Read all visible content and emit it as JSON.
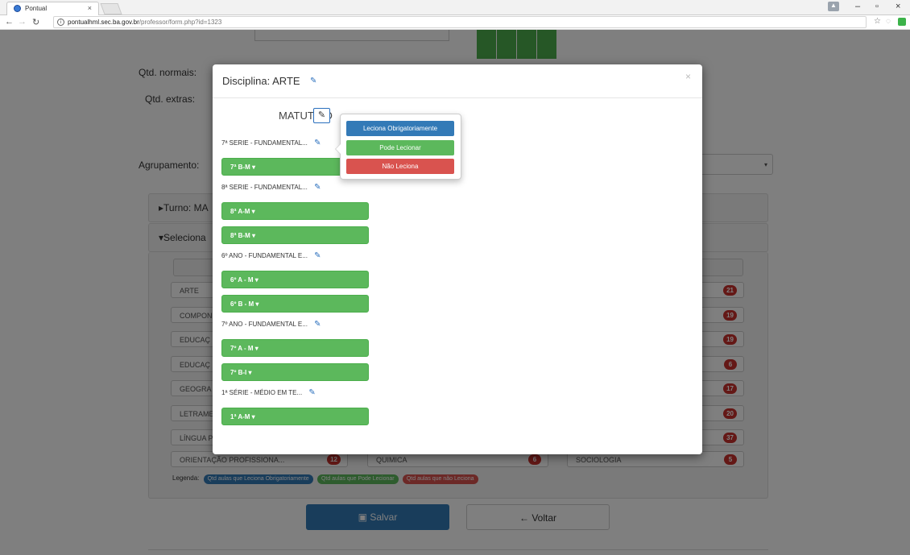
{
  "browser": {
    "tab_title": "Pontual",
    "url_host": "pontualhml.sec.ba.gov.br",
    "url_path": "/professor/form.php?id=1323",
    "tab_close": "×",
    "min": "–",
    "max": "▫",
    "close": "×",
    "star": "☆"
  },
  "page": {
    "qtd_normais": "Qtd. normais:",
    "qtd_extras": "Qtd. extras:",
    "agrupamento": "Agrupamento:",
    "turno": "▸Turno: MA",
    "seleciona": "▾Seleciona",
    "subjects": [
      {
        "name": "ARTE",
        "count": "21"
      },
      {
        "name": "COMPON",
        "count": "19"
      },
      {
        "name": "EDUCAÇ",
        "count": "19"
      },
      {
        "name": "EDUCAÇ",
        "count": "6"
      },
      {
        "name": "GEOGRA",
        "count": "17"
      },
      {
        "name": "LETRAME",
        "count": "20"
      },
      {
        "name": "LÍNGUA P",
        "count": "37"
      }
    ],
    "bottom_row": [
      {
        "name": "ORIENTAÇÃO PROFISSIONA...",
        "count": "12"
      },
      {
        "name": "QUIMICA",
        "count": "6"
      },
      {
        "name": "SOCIOLOGIA",
        "count": "5"
      }
    ],
    "legend_label": "Legenda:",
    "legend": [
      {
        "text": "Qtd aulas que Leciona Obrigatoriamente",
        "color": "#337ab7"
      },
      {
        "text": "Qtd aulas que Pode Lecionar",
        "color": "#5cb85c"
      },
      {
        "text": "Qtd aulas que não Leciona",
        "color": "#d9534f"
      }
    ],
    "save_label": "Salvar",
    "back_label": "Voltar"
  },
  "modal": {
    "title": "Disciplina: ARTE",
    "close": "×",
    "shift": "MATUTINO",
    "groups": [
      {
        "title": "7ª SERIE - FUNDAMENTAL...",
        "classes": [
          "7ª B-M ▾"
        ]
      },
      {
        "title": "8ª SERIE - FUNDAMENTAL...",
        "classes": [
          "8ª A-M ▾",
          "8ª B-M ▾"
        ]
      },
      {
        "title": "6º ANO - FUNDAMENTAL E...",
        "classes": [
          "6º A - M ▾",
          "6º B - M ▾"
        ]
      },
      {
        "title": "7º ANO - FUNDAMENTAL E...",
        "classes": [
          "7º A - M ▾",
          "7º B-I ▾"
        ]
      },
      {
        "title": "1ª SÉRIE - MÉDIO EM TE...",
        "classes": [
          "1ª A-M ▾"
        ]
      }
    ]
  },
  "popover": {
    "opt1": "Leciona Obrigatoriamente",
    "opt2": "Pode Lecionar",
    "opt3": "Não Leciona"
  },
  "colors": {
    "blue": "#337ab7",
    "green": "#5cb85c",
    "red": "#d9534f"
  }
}
